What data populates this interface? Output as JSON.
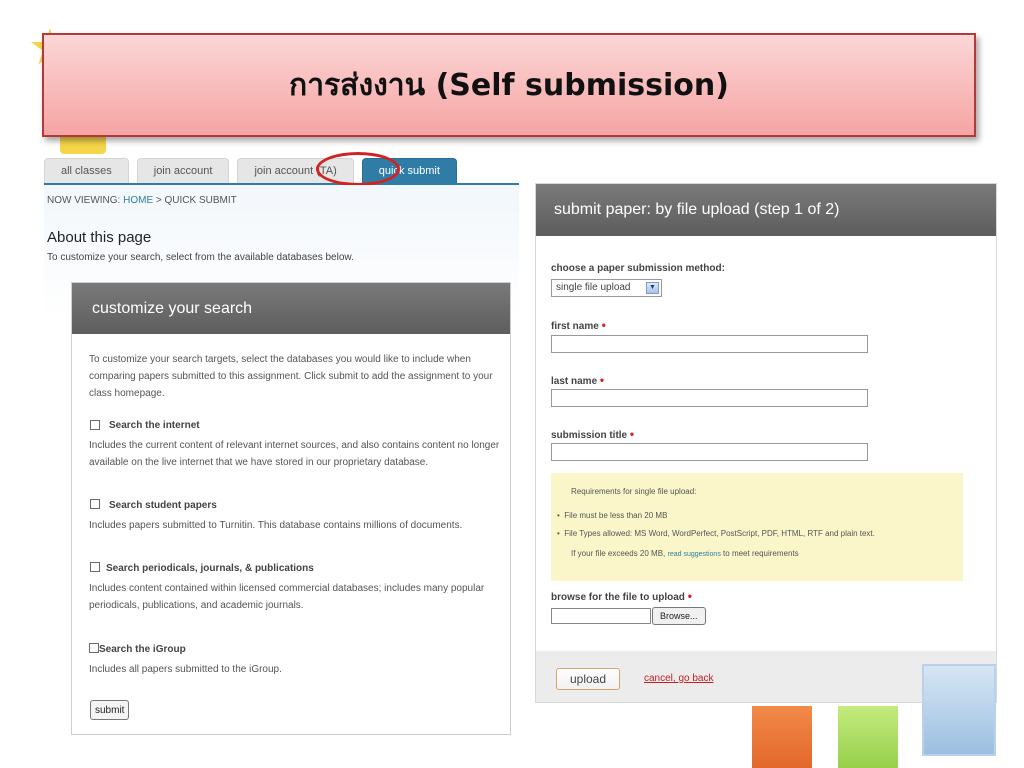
{
  "slide_title": "การส่งงาน (Self submission)",
  "tabs": [
    "all classes",
    "join account",
    "join account (TA)",
    "quick submit"
  ],
  "breadcrumb": {
    "prefix": "NOW VIEWING: ",
    "home": "HOME",
    "sep": " > ",
    "current": "QUICK SUBMIT"
  },
  "about": {
    "title": "About this page",
    "desc": "To customize your search, select from the available databases below."
  },
  "customize": {
    "heading": "customize your search",
    "intro": "To customize your search targets, select the databases you would like to include when comparing papers submitted to this assignment. Click submit to add the assignment to your class homepage.",
    "options": [
      {
        "title": "Search the internet",
        "desc": "Includes the current content of relevant internet sources, and also contains content no longer available on the live internet that we have stored in our proprietary database."
      },
      {
        "title": "Search student papers",
        "desc": "Includes papers submitted to Turnitin. This database contains millions of documents."
      },
      {
        "title": "Search periodicals, journals, & publications",
        "desc": "Includes content contained within licensed commercial databases; includes many popular periodicals, publications, and academic journals."
      },
      {
        "title": "Search the iGroup",
        "desc": "Includes all papers submitted to the iGroup."
      }
    ],
    "submit_label": "submit"
  },
  "submit_paper": {
    "heading": "submit paper: by file upload (step 1 of 2)",
    "method_label": "choose a paper submission method:",
    "method_value": "single file upload",
    "first_name_label": "first name",
    "last_name_label": "last name",
    "title_label": "submission title",
    "required_mark": "•",
    "requirements": {
      "heading": "Requirements for single file upload:",
      "items": [
        "File must be less than 20 MB",
        "File Types allowed: MS Word, WordPerfect, PostScript, PDF, HTML, RTF and plain text."
      ],
      "note_before": "If your file exceeds 20 MB, ",
      "note_link": "read suggestions",
      "note_after": " to meet requirements"
    },
    "browse_label": "browse for the file to upload",
    "browse_button": "Browse...",
    "upload_button": "upload",
    "cancel_link": "cancel, go back"
  },
  "colors": {
    "accent": "#2f7da6",
    "banner_border": "#b33a3a",
    "required": "#e01f1f"
  },
  "icons": {
    "dropdown": "chevron-down-icon",
    "decor": "star-icon"
  }
}
